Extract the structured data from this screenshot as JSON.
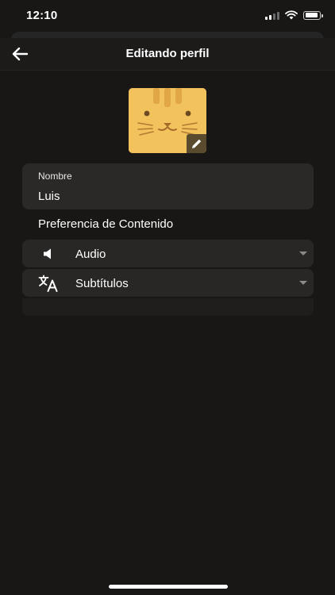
{
  "status_bar": {
    "time": "12:10",
    "icons": [
      "signal-icon",
      "wifi-icon",
      "battery-icon"
    ]
  },
  "header": {
    "title": "Editando perfil",
    "back_icon": "arrow-left-icon"
  },
  "avatar": {
    "icon": "cat-face-icon",
    "edit_icon": "pencil-icon",
    "color": "#f2c25c"
  },
  "profile": {
    "name_label": "Nombre",
    "name_value": "Luis"
  },
  "content_preferences": {
    "title": "Preferencia de Contenido",
    "audio": {
      "icon": "speaker-icon",
      "label": "Audio"
    },
    "subtitles": {
      "icon": "translate-icon",
      "label": "Subtítulos"
    }
  },
  "colors": {
    "background": "#181716",
    "card": "#2a2928",
    "accent": "#f2c25c"
  }
}
